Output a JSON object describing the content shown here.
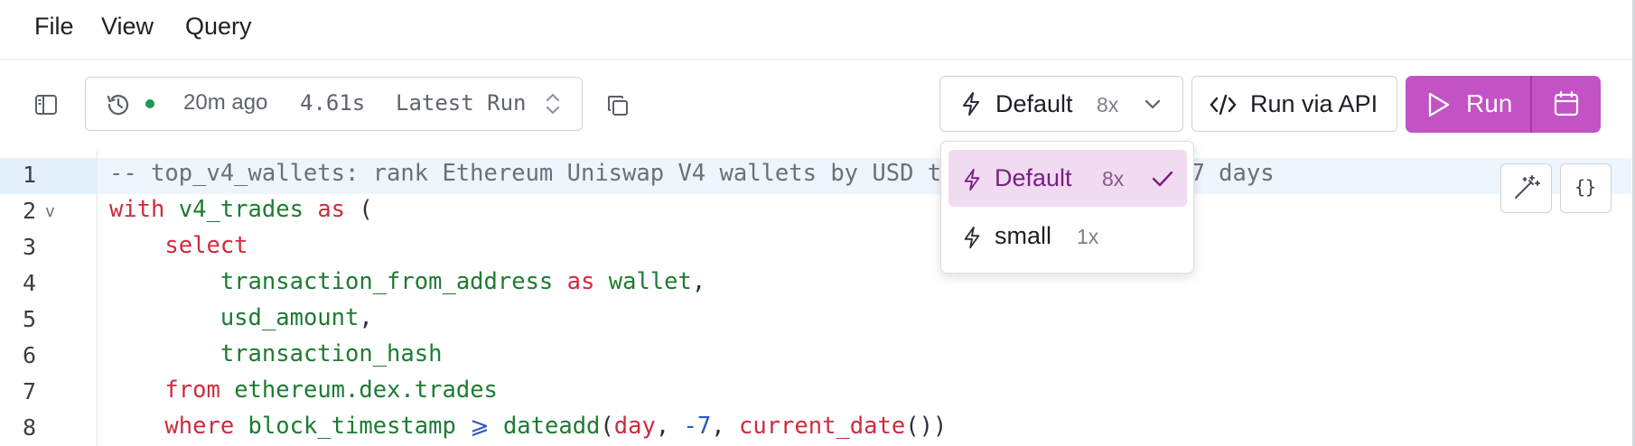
{
  "menu": [
    "File",
    "View",
    "Query"
  ],
  "toolbar": {
    "sidebar_icon": "sidebar-toggle-icon",
    "run_history": {
      "icon": "history-icon",
      "status_color": "#1a9a4a",
      "time_ago": "20m ago",
      "duration": "4.61s",
      "label": "Latest Run"
    },
    "copy_icon": "copy-icon",
    "engine": {
      "name": "Default",
      "multiplier": "8x"
    },
    "api_label": "Run via API",
    "run_label": "Run",
    "accent_color": "#c352c5"
  },
  "engine_dropdown": {
    "options": [
      {
        "name": "Default",
        "multiplier": "8x",
        "selected": true
      },
      {
        "name": "small",
        "multiplier": "1x",
        "selected": false
      }
    ]
  },
  "editor": {
    "line_numbers": [
      "1",
      "2",
      "3",
      "4",
      "5",
      "6",
      "7",
      "8"
    ],
    "fold_marker": "v",
    "format_label": "{}",
    "lines": [
      [
        {
          "t": "-- top_v4_wallets: rank Ethereum Uniswap V4 wallets by USD trade volume, last 7 days",
          "c": "cm"
        }
      ],
      [
        {
          "t": "with",
          "c": "kw"
        },
        {
          "t": " "
        },
        {
          "t": "v4_trades",
          "c": "id"
        },
        {
          "t": " "
        },
        {
          "t": "as",
          "c": "kw"
        },
        {
          "t": " ("
        }
      ],
      [
        {
          "t": "    "
        },
        {
          "t": "select",
          "c": "kw"
        }
      ],
      [
        {
          "t": "        "
        },
        {
          "t": "transaction_from_address",
          "c": "id"
        },
        {
          "t": " "
        },
        {
          "t": "as",
          "c": "kw"
        },
        {
          "t": " "
        },
        {
          "t": "wallet",
          "c": "id"
        },
        {
          "t": ","
        }
      ],
      [
        {
          "t": "        "
        },
        {
          "t": "usd_amount",
          "c": "id"
        },
        {
          "t": ","
        }
      ],
      [
        {
          "t": "        "
        },
        {
          "t": "transaction_hash",
          "c": "id"
        }
      ],
      [
        {
          "t": "    "
        },
        {
          "t": "from",
          "c": "kw"
        },
        {
          "t": " "
        },
        {
          "t": "ethereum.dex.trades",
          "c": "id"
        }
      ],
      [
        {
          "t": "    "
        },
        {
          "t": "where",
          "c": "kw"
        },
        {
          "t": " "
        },
        {
          "t": "block_timestamp",
          "c": "id"
        },
        {
          "t": " "
        },
        {
          "t": "⩾",
          "c": "op"
        },
        {
          "t": " "
        },
        {
          "t": "dateadd",
          "c": "id"
        },
        {
          "t": "("
        },
        {
          "t": "day",
          "c": "kw"
        },
        {
          "t": ", "
        },
        {
          "t": "-7",
          "c": "num"
        },
        {
          "t": ", "
        },
        {
          "t": "current_date",
          "c": "kw"
        },
        {
          "t": "())"
        }
      ]
    ]
  }
}
